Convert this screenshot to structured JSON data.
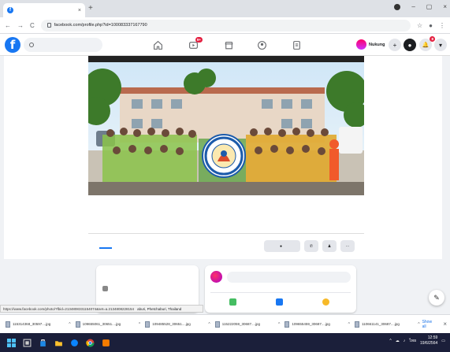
{
  "browser": {
    "tab_title": "",
    "tab_close": "×",
    "new_tab": "+",
    "url": "facebook.com/profile.php?id=100083337167790",
    "controls": [
      "–",
      "▢",
      "×"
    ]
  },
  "fb_header": {
    "logo": "f",
    "search_placeholder": "",
    "notif_badge_watch": "9+",
    "notif_badge_bell": "8",
    "profile_name": "Nukung",
    "plus": "+"
  },
  "page": {
    "name": "",
    "subtitle": "",
    "tabs": [
      "",
      "",
      "",
      "",
      "",
      ""
    ],
    "message_button": "",
    "more_button": "···"
  },
  "intro": {
    "heading": "",
    "rows": [
      {
        "text": ""
      },
      {
        "text": "aburi, Phetchaburi, Thailand"
      }
    ]
  },
  "post_box": {
    "placeholder": "",
    "actions": [
      {
        "label": "",
        "color": "#45bd62"
      },
      {
        "label": "",
        "color": "#1877f2"
      },
      {
        "label": "",
        "color": "#f7b928"
      }
    ]
  },
  "status_link": "https://www.facebook.com/photo/?fbid=2134808331154074&set=a.2134808228154",
  "downloads": {
    "files": [
      "115314368_30597....jpg",
      "109655061_30651....jpg",
      "109485528_30651....jpg",
      "115222059_30687....jpg",
      "109655459_30687....jpg",
      "110661141_30687....jpg"
    ],
    "show_all": "Show all",
    "close": "×"
  },
  "taskbar": {
    "time": "12:59",
    "date": "19/6/2564",
    "lang": "ไทย"
  },
  "colors": {
    "fb_blue": "#1877f2",
    "taskbar": "#1b1f3a",
    "badge": "#e41e3f"
  }
}
